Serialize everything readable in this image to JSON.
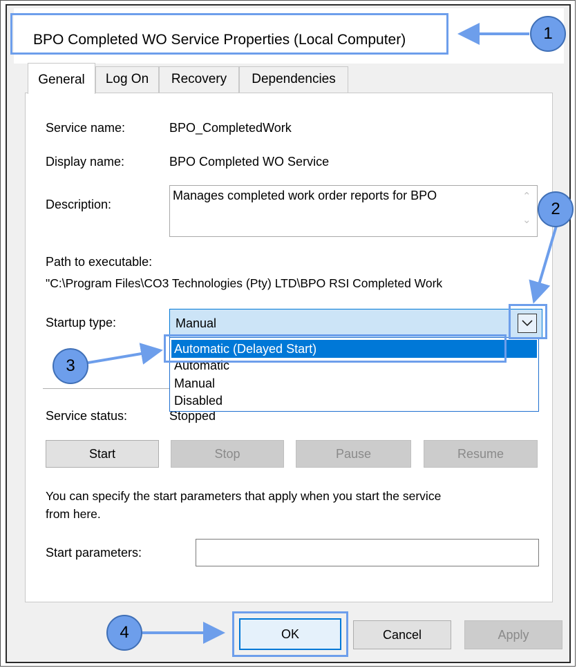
{
  "window": {
    "title": "BPO Completed WO Service Properties (Local Computer)"
  },
  "tabs": [
    {
      "label": "General",
      "active": true
    },
    {
      "label": "Log On"
    },
    {
      "label": "Recovery"
    },
    {
      "label": "Dependencies"
    }
  ],
  "general": {
    "service_name_label": "Service name:",
    "service_name_value": "BPO_CompletedWork",
    "display_name_label": "Display name:",
    "display_name_value": "BPO Completed WO Service",
    "description_label": "Description:",
    "description_value": "Manages completed work order reports for BPO",
    "path_label": "Path to executable:",
    "path_value": "\"C:\\Program Files\\CO3 Technologies (Pty) LTD\\BPO RSI Completed Work",
    "startup_type_label": "Startup type:",
    "startup_type_value": "Manual",
    "startup_options": [
      "Automatic (Delayed Start)",
      "Automatic",
      "Manual",
      "Disabled"
    ],
    "service_status_label": "Service status:",
    "service_status_value": "Stopped",
    "buttons": {
      "start": "Start",
      "stop": "Stop",
      "pause": "Pause",
      "resume": "Resume"
    },
    "hint_line1": "You can specify the start parameters that apply when you start the service",
    "hint_line2": "from here.",
    "start_params_label": "Start parameters:",
    "start_params_value": ""
  },
  "footer": {
    "ok": "OK",
    "cancel": "Cancel",
    "apply": "Apply"
  },
  "annotations": {
    "badge1": "1",
    "badge2": "2",
    "badge3": "3",
    "badge4": "4"
  },
  "colors": {
    "annotation": "#6d9eeb",
    "selection": "#0078d7"
  }
}
